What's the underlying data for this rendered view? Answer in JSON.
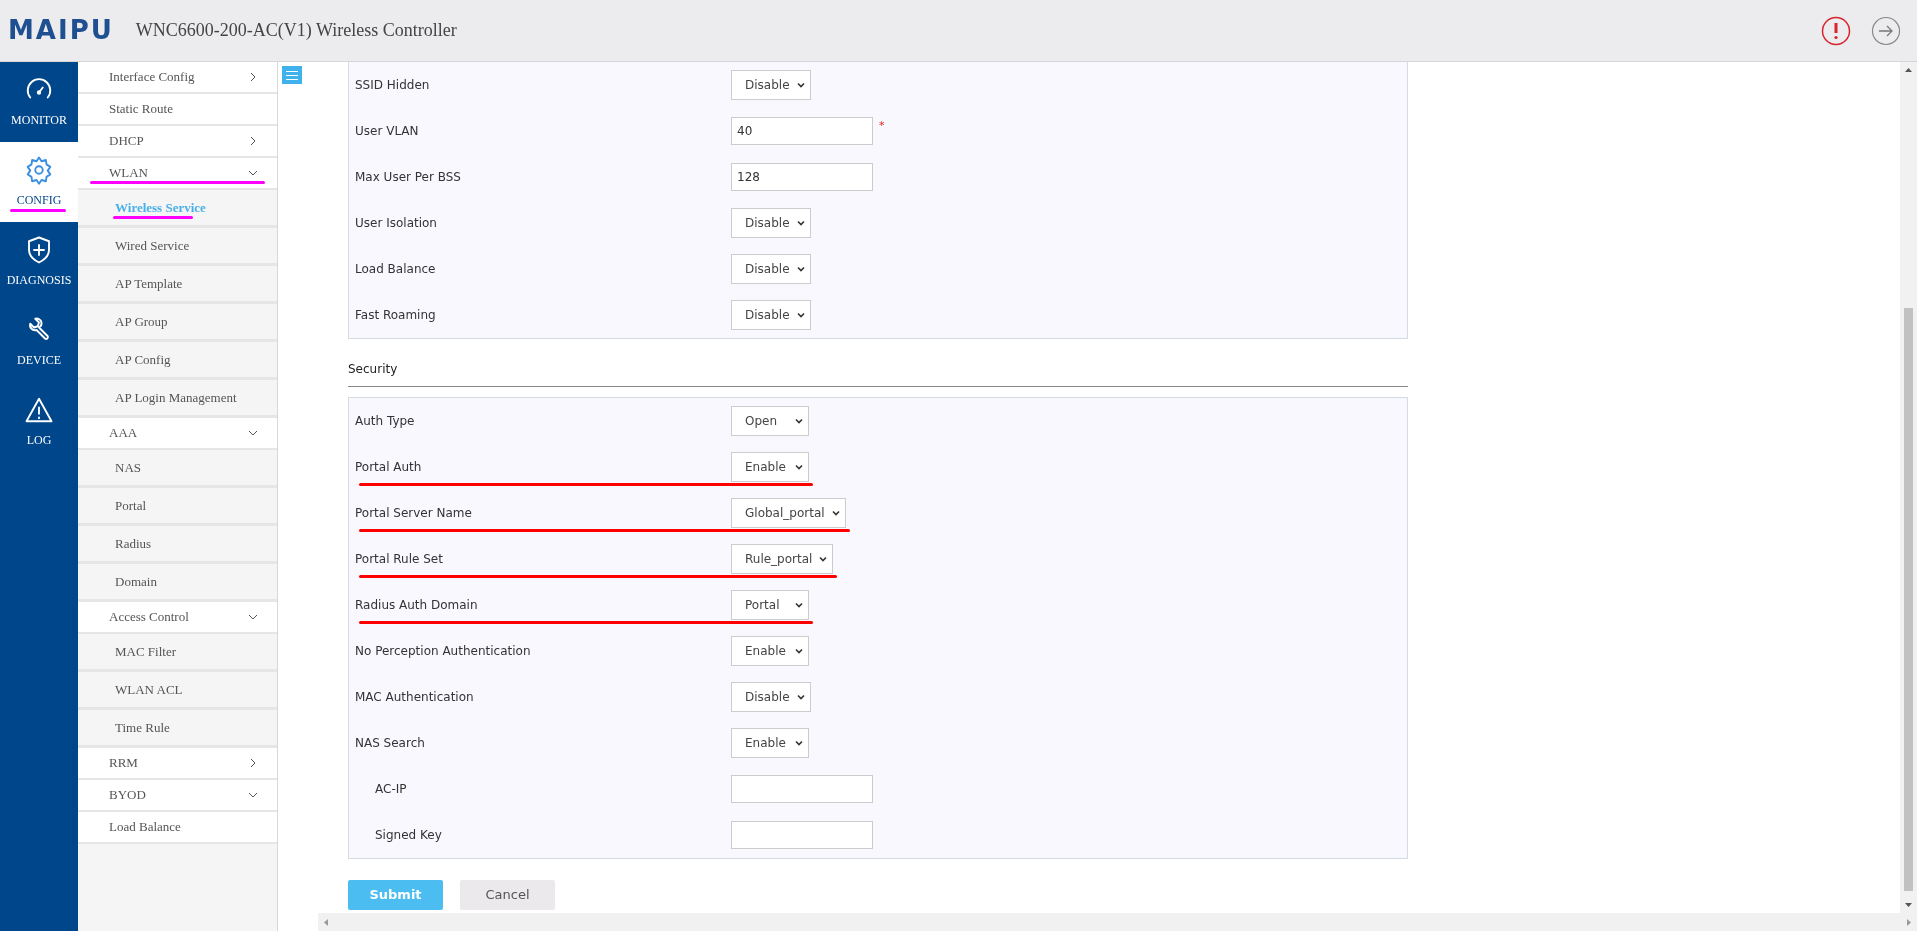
{
  "header": {
    "logo": "MAIPU",
    "title": "WNC6600-200-AC(V1) Wireless Controller"
  },
  "nav": [
    {
      "label": "MONITOR",
      "kind": "gauge",
      "selected": false,
      "annotated": false
    },
    {
      "label": "CONFIG",
      "kind": "gear",
      "selected": true,
      "annotated": true
    },
    {
      "label": "DIAGNOSIS",
      "kind": "shield",
      "selected": false,
      "annotated": false
    },
    {
      "label": "DEVICE",
      "kind": "wrench",
      "selected": false,
      "annotated": false
    },
    {
      "label": "LOG",
      "kind": "warning",
      "selected": false,
      "annotated": false
    }
  ],
  "menu": [
    {
      "label": "Interface Config",
      "kind": "group",
      "expanded": false,
      "annotated": false
    },
    {
      "label": "Static Route",
      "kind": "link",
      "annotated": false
    },
    {
      "label": "DHCP",
      "kind": "group",
      "expanded": false,
      "annotated": false
    },
    {
      "label": "WLAN",
      "kind": "group",
      "expanded": true,
      "annotated": true,
      "children": [
        {
          "label": "Wireless Service",
          "selected": true,
          "annotated": true
        },
        {
          "label": "Wired Service",
          "selected": false,
          "annotated": false
        },
        {
          "label": "AP Template",
          "selected": false,
          "annotated": false
        },
        {
          "label": "AP Group",
          "selected": false,
          "annotated": false
        },
        {
          "label": "AP Config",
          "selected": false,
          "annotated": false
        },
        {
          "label": "AP Login Management",
          "selected": false,
          "annotated": false
        }
      ]
    },
    {
      "label": "AAA",
      "kind": "group",
      "expanded": true,
      "annotated": false,
      "children": [
        {
          "label": "NAS",
          "selected": false,
          "annotated": false
        },
        {
          "label": "Portal",
          "selected": false,
          "annotated": false
        },
        {
          "label": "Radius",
          "selected": false,
          "annotated": false
        },
        {
          "label": "Domain",
          "selected": false,
          "annotated": false
        }
      ]
    },
    {
      "label": "Access Control",
      "kind": "group",
      "expanded": true,
      "annotated": false,
      "children": [
        {
          "label": "MAC Filter",
          "selected": false,
          "annotated": false
        },
        {
          "label": "WLAN ACL",
          "selected": false,
          "annotated": false
        },
        {
          "label": "Time Rule",
          "selected": false,
          "annotated": false
        }
      ]
    },
    {
      "label": "RRM",
      "kind": "group",
      "expanded": false,
      "annotated": false
    },
    {
      "label": "BYOD",
      "kind": "group",
      "expanded": true,
      "annotated": false
    },
    {
      "label": "Load Balance",
      "kind": "link",
      "annotated": false
    }
  ],
  "form": {
    "sections": [
      {
        "fields": [
          {
            "label": "SSID Hidden",
            "kind": "select",
            "value": "Disable",
            "indented": false,
            "annotated": false
          },
          {
            "label": "User VLAN",
            "kind": "input",
            "value": "40",
            "indented": false,
            "required_mark": "*",
            "annotated": false
          },
          {
            "label": "Max User Per BSS",
            "kind": "input",
            "value": "128",
            "indented": false,
            "annotated": false
          },
          {
            "label": "User Isolation",
            "kind": "select",
            "value": "Disable",
            "indented": false,
            "annotated": false
          },
          {
            "label": "Load Balance",
            "kind": "select",
            "value": "Disable",
            "indented": false,
            "annotated": false
          },
          {
            "label": "Fast Roaming",
            "kind": "select",
            "value": "Disable",
            "indented": false,
            "annotated": false
          }
        ]
      },
      {
        "title": "Security",
        "fields": [
          {
            "label": "Auth Type",
            "kind": "select",
            "value": "Open",
            "indented": false,
            "annotated": false
          },
          {
            "label": "Portal Auth",
            "kind": "select",
            "value": "Enable",
            "indented": false,
            "annotated": true
          },
          {
            "label": "Portal Server Name",
            "kind": "select",
            "value": "Global_portal",
            "indented": false,
            "annotated": true
          },
          {
            "label": "Portal Rule Set",
            "kind": "select",
            "value": "Rule_portal",
            "indented": false,
            "annotated": true
          },
          {
            "label": "Radius Auth Domain",
            "kind": "select",
            "value": "Portal",
            "indented": false,
            "annotated": true
          },
          {
            "label": "No Perception Authentication",
            "kind": "select",
            "value": "Enable",
            "indented": false,
            "annotated": false
          },
          {
            "label": "MAC Authentication",
            "kind": "select",
            "value": "Disable",
            "indented": false,
            "annotated": false
          },
          {
            "label": "NAS Search",
            "kind": "select",
            "value": "Enable",
            "indented": false,
            "annotated": false
          },
          {
            "label": "AC-IP",
            "kind": "input",
            "indented": true,
            "annotated": false
          },
          {
            "label": "Signed Key",
            "kind": "input",
            "indented": true,
            "annotated": false
          }
        ]
      }
    ],
    "buttons": [
      {
        "label": "Submit",
        "kind": "primary"
      },
      {
        "label": "Cancel",
        "kind": "secondary"
      }
    ]
  }
}
